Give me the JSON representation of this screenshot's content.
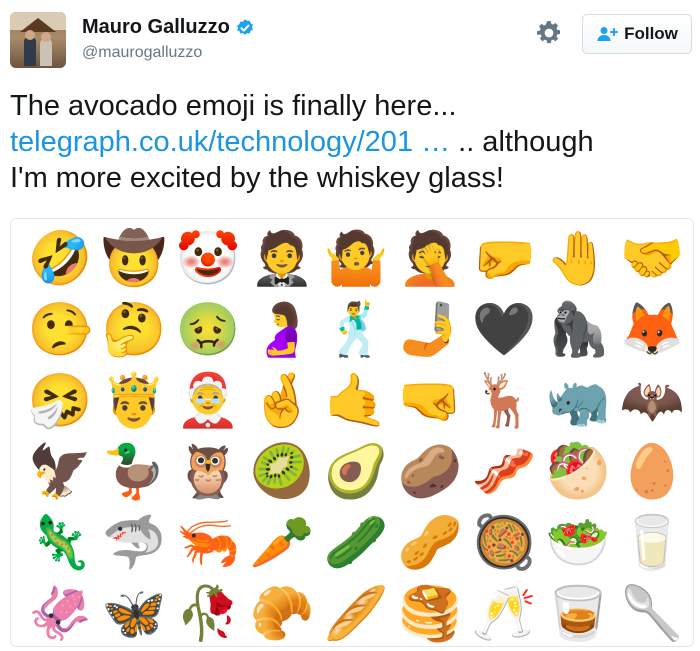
{
  "author": {
    "display_name": "Mauro Galluzzo",
    "handle": "@maurogalluzzo",
    "verified_icon": "verified-badge-icon"
  },
  "actions": {
    "follow_label": "Follow",
    "settings_icon": "gear-icon"
  },
  "tweet": {
    "line1": "The avocado emoji is finally here...",
    "link_text": "telegraph.co.uk/technology/201",
    "link_ellipsis": "…",
    "line2_tail": ".. although",
    "line3": "I'm more excited by the whiskey glass!"
  },
  "media": {
    "accent_link_color": "#1b95e0",
    "emoji_rows": [
      [
        "🤣",
        "🤠",
        "🤡",
        "🤵",
        "🤷",
        "🤦",
        "🤛",
        "🤚",
        "🤝"
      ],
      [
        "🤥",
        "🤔",
        "🤢",
        "🤰",
        "🕺",
        "🤳",
        "🖤",
        "🦍",
        "🦊"
      ],
      [
        "🤧",
        "🤴",
        "🤶",
        "🤞",
        "🤙",
        "🤜",
        "🦌",
        "🦏",
        "🦇"
      ],
      [
        "🦅",
        "🦆",
        "🦉",
        "🥝",
        "🥑",
        "🥔",
        "🥓",
        "🥙",
        "🥚"
      ],
      [
        "🦎",
        "🦈",
        "🦐",
        "🥕",
        "🥒",
        "🥜",
        "🥘",
        "🥗",
        "🥛"
      ],
      [
        "🦑",
        "🦋",
        "🥀",
        "🥐",
        "🥖",
        "🥞",
        "🥂",
        "🥃",
        "🥄"
      ]
    ]
  }
}
